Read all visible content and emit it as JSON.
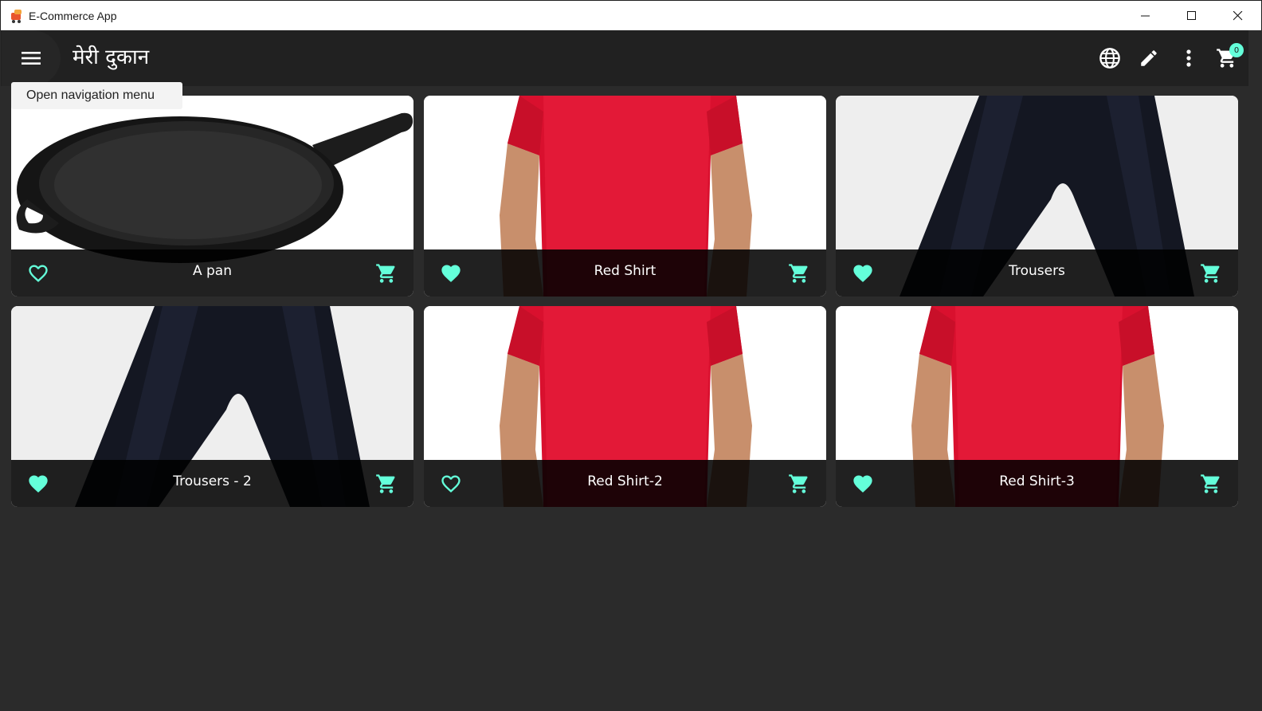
{
  "window": {
    "title": "E-Commerce App"
  },
  "appbar": {
    "title": "मेरी दुकान",
    "cart_count": "0"
  },
  "tooltip": {
    "text": "Open navigation menu"
  },
  "colors": {
    "accent": "#64ffda",
    "appbar": "#212121",
    "background": "#2b2b2b"
  },
  "products": [
    {
      "name": "A pan",
      "favorite": false,
      "image": "frying-pan"
    },
    {
      "name": "Red Shirt",
      "favorite": true,
      "image": "red-shirt"
    },
    {
      "name": "Trousers",
      "favorite": true,
      "image": "trousers"
    },
    {
      "name": "Trousers - 2",
      "favorite": true,
      "image": "trousers"
    },
    {
      "name": "Red Shirt-2",
      "favorite": false,
      "image": "red-shirt"
    },
    {
      "name": "Red Shirt-3",
      "favorite": true,
      "image": "red-shirt"
    }
  ]
}
